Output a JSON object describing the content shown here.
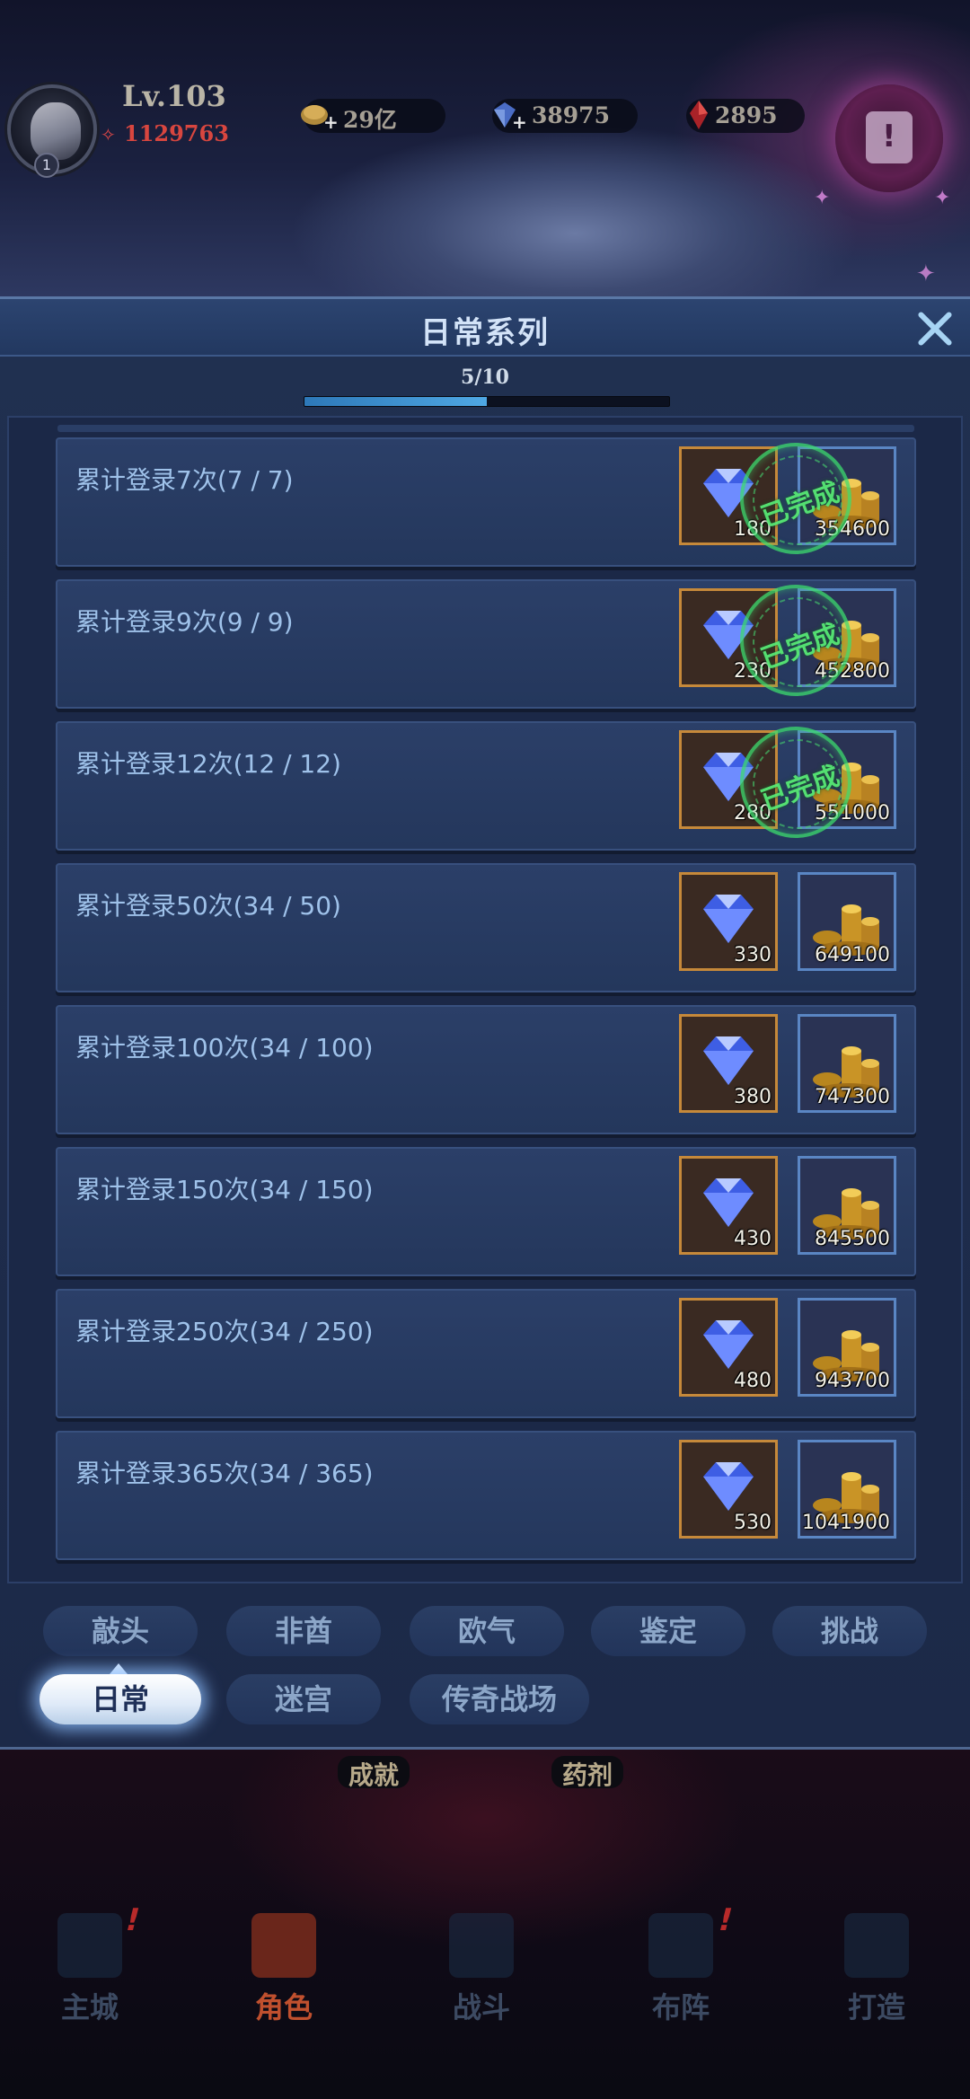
{
  "hud": {
    "level": "Lv.103",
    "power": "1129763",
    "avatar_badge": "1",
    "resources": [
      {
        "icon": "gold-icon",
        "value": "29亿"
      },
      {
        "icon": "diamond-icon",
        "value": "38975"
      },
      {
        "icon": "ruby-icon",
        "value": "2895"
      }
    ]
  },
  "panel": {
    "title": "日常系列",
    "progress_text": "5/10",
    "progress_fraction": 0.5,
    "rows": [
      {
        "label": "累计登录7次(7 / 7)",
        "gem_qty": "180",
        "gold_qty": "354600",
        "completed": true
      },
      {
        "label": "累计登录9次(9 / 9)",
        "gem_qty": "230",
        "gold_qty": "452800",
        "completed": true
      },
      {
        "label": "累计登录12次(12 / 12)",
        "gem_qty": "280",
        "gold_qty": "551000",
        "completed": true
      },
      {
        "label": "累计登录50次(34 / 50)",
        "gem_qty": "330",
        "gold_qty": "649100",
        "completed": false
      },
      {
        "label": "累计登录100次(34 / 100)",
        "gem_qty": "380",
        "gold_qty": "747300",
        "completed": false
      },
      {
        "label": "累计登录150次(34 / 150)",
        "gem_qty": "430",
        "gold_qty": "845500",
        "completed": false
      },
      {
        "label": "累计登录250次(34 / 250)",
        "gem_qty": "480",
        "gold_qty": "943700",
        "completed": false
      },
      {
        "label": "累计登录365次(34 / 365)",
        "gem_qty": "530",
        "gold_qty": "1041900",
        "completed": false
      }
    ],
    "stamp_text": "已完成"
  },
  "tabs": {
    "row1": [
      "敲头",
      "非酋",
      "欧气",
      "鉴定",
      "挑战"
    ],
    "row2": [
      "日常",
      "迷宫",
      "传奇战场"
    ],
    "active": "日常"
  },
  "scene": {
    "labels": [
      "成就",
      "药剂"
    ]
  },
  "nav": {
    "items": [
      "主城",
      "角色",
      "战斗",
      "布阵",
      "打造"
    ],
    "active": "角色"
  },
  "colors": {
    "accent": "#4fa8e4",
    "gem_border": "#c6893a",
    "gold_border": "#5a86c4",
    "stamp": "#3cdc6e"
  }
}
